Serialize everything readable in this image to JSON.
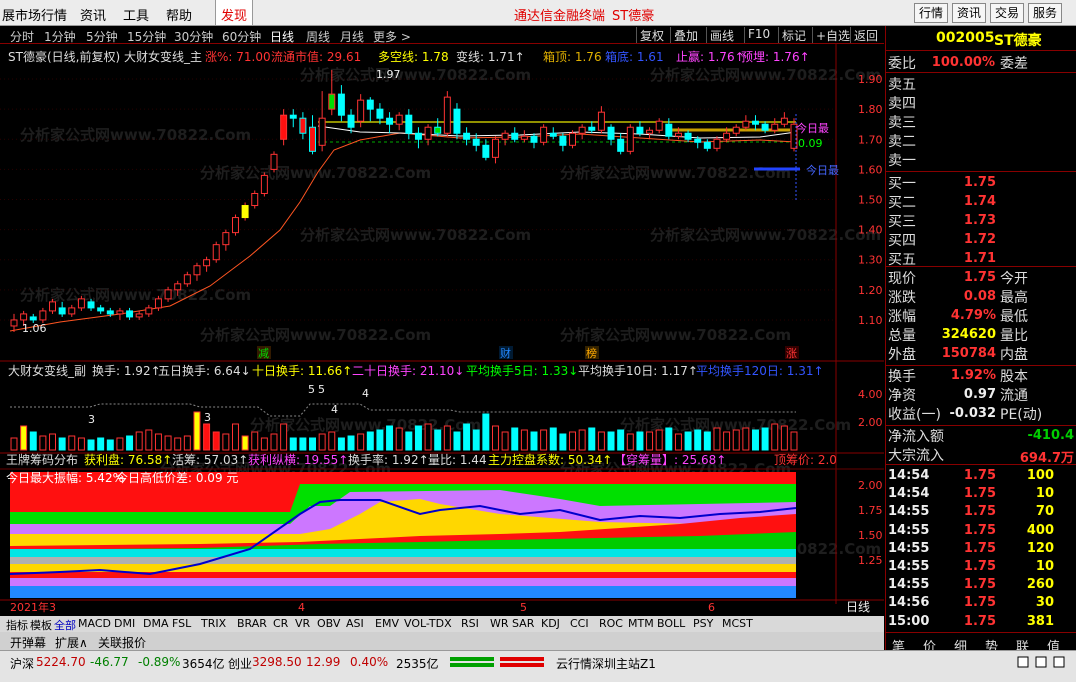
{
  "menu": {
    "left_items": [
      "展市场行情",
      "资讯",
      "工具",
      "帮助"
    ],
    "discover": "发现",
    "center": "通达信金融终端",
    "stock_title": "ST德豪",
    "buttons": [
      "行情",
      "资讯",
      "交易",
      "服务"
    ]
  },
  "timeframes": [
    "分时",
    "1分钟",
    "5分钟",
    "15分钟",
    "30分钟",
    "60分钟",
    "日线",
    "周线",
    "月线",
    "更多 >"
  ],
  "toolbar": [
    "复权",
    "叠加",
    "画线",
    "F10",
    "标记",
    "+自选",
    "返回"
  ],
  "main_header": {
    "name": "ST德豪(日线,前复权) 大财女变线_主",
    "zhang": "涨%: 71.00",
    "ltsz": "流通市值: 29.61",
    "dkx": "多空线: 1.78",
    "bxx": "变线: 1.71↑",
    "xd": "箱顶: 1.76",
    "xdi": "箱底: 1.61",
    "zy": "止赢: 1.76↑",
    "yl": "预埋: 1.76↑"
  },
  "main_axis": [
    "1.90",
    "1.80",
    "1.70",
    "1.60",
    "1.50",
    "1.40",
    "1.30",
    "1.20",
    "1.10"
  ],
  "main_labels": {
    "high": "1.97",
    "low": "1.06",
    "today_high": "今日最",
    "today_low": "今日最",
    "diff": "0.09"
  },
  "events": [
    "减",
    "财",
    "榜",
    "涨"
  ],
  "sub_header": {
    "name": "大财女变线_副",
    "hs": "换手: 1.92↑",
    "hs5": "五日换手: 6.64↓",
    "hs10": "十日换手: 11.66↑",
    "hs20": "二十日换手: 21.10↓",
    "avg5": "平均换手5日: 1.33↓",
    "avg10": "平均换手10日: 1.17↑",
    "avg120": "平均换手120日: 1.31↑"
  },
  "sub_axis": [
    "4.00",
    "2.00"
  ],
  "sub_labels": [
    "3",
    "3",
    "5",
    "5",
    "4",
    "4"
  ],
  "chip_header": {
    "name": "王牌筹码分布",
    "hl": "获利盘: 76.58↑",
    "hy": "活筹: 57.03↑",
    "hlzz": "获利纵横: 19.55↑",
    "hsl": "换手率: 1.92↑",
    "lb": "量比: 1.44",
    "zl": "主力控盘系数: 50.34↑",
    "cm": "【穿筹量】: 25.68↑",
    "dcj": "顶筹价: 2.0"
  },
  "chip_sub": {
    "zf": "今日最大振幅: 5.42%",
    "gd": "今日高低价差: 0.09 元"
  },
  "chip_axis": [
    "2.00",
    "1.75",
    "1.50",
    "1.25"
  ],
  "xaxis": {
    "year": "2021年3",
    "m4": "4",
    "m5": "5",
    "m6": "6",
    "period": "日线"
  },
  "indicator_tabs": [
    "指标",
    "模板",
    "全部",
    "MACD",
    "DMI",
    "DMA",
    "FSL",
    "TRIX",
    "BRAR",
    "CR",
    "VR",
    "OBV",
    "ASI",
    "EMV",
    "VOL-TDX",
    "RSI",
    "WR",
    "SAR",
    "KDJ",
    "CCI",
    "ROC",
    "MTM",
    "BOLL",
    "PSY",
    "MCST"
  ],
  "bottom_tabs": [
    "开弹幕",
    "扩展∧",
    "关联报价"
  ],
  "right": {
    "code": "002005",
    "name": "ST德豪",
    "wb_label": "委比",
    "wb_val": "100.00%",
    "wc_label": "委差",
    "asks": [
      "卖五",
      "卖四",
      "卖三",
      "卖二",
      "卖一"
    ],
    "bids": [
      {
        "l": "买一",
        "p": "1.75",
        "v": ""
      },
      {
        "l": "买二",
        "p": "1.74",
        "v": ""
      },
      {
        "l": "买三",
        "p": "1.73",
        "v": ""
      },
      {
        "l": "买四",
        "p": "1.72",
        "v": ""
      },
      {
        "l": "买五",
        "p": "1.71",
        "v": ""
      }
    ],
    "quote": [
      {
        "l": "现价",
        "v": "1.75",
        "r": "今开"
      },
      {
        "l": "涨跌",
        "v": "0.08",
        "r": "最高"
      },
      {
        "l": "涨幅",
        "v": "4.79%",
        "r": "最低"
      },
      {
        "l": "总量",
        "v": "324620",
        "r": "量比"
      },
      {
        "l": "外盘",
        "v": "150784",
        "r": "内盘"
      }
    ],
    "quote2": [
      {
        "l": "换手",
        "v": "1.92%",
        "r": "股本"
      },
      {
        "l": "净资",
        "v": "0.97",
        "r": "流通"
      },
      {
        "l": "收益(一)",
        "v": "-0.032",
        "r": "PE(动)"
      }
    ],
    "flow": [
      {
        "l": "净流入额",
        "v": "-410.4"
      },
      {
        "l": "大宗流入",
        "v": "694.7万"
      }
    ],
    "ticks": [
      {
        "t": "14:54",
        "p": "1.75",
        "v": "100"
      },
      {
        "t": "14:54",
        "p": "1.75",
        "v": "10"
      },
      {
        "t": "14:55",
        "p": "1.75",
        "v": "70"
      },
      {
        "t": "14:55",
        "p": "1.75",
        "v": "400"
      },
      {
        "t": "14:55",
        "p": "1.75",
        "v": "120"
      },
      {
        "t": "14:55",
        "p": "1.75",
        "v": "10"
      },
      {
        "t": "14:55",
        "p": "1.75",
        "v": "260"
      },
      {
        "t": "14:56",
        "p": "1.75",
        "v": "30"
      },
      {
        "t": "15:00",
        "p": "1.75",
        "v": "381"
      }
    ],
    "rtabs": [
      "笔",
      "价",
      "细",
      "势",
      "联",
      "值"
    ]
  },
  "status": {
    "sh": "沪深",
    "sh_v": "5224.70",
    "sh_c": "-46.77",
    "sh_p": "-0.89%",
    "sh_a": "3654亿",
    "cy": "创业",
    "cy_v": "3298.50",
    "cy_c": "12.99",
    "cy_p": "0.40%",
    "cy_a": "2535亿",
    "server": "云行情深圳主站Z1"
  },
  "watermark": "分析家公式网www.70822.Com",
  "candles": [
    {
      "o": 1.08,
      "c": 1.1,
      "h": 1.12,
      "l": 1.06
    },
    {
      "o": 1.1,
      "c": 1.12,
      "h": 1.13,
      "l": 1.08
    },
    {
      "o": 1.11,
      "c": 1.1,
      "h": 1.12,
      "l": 1.09
    },
    {
      "o": 1.1,
      "c": 1.13,
      "h": 1.14,
      "l": 1.09
    },
    {
      "o": 1.13,
      "c": 1.16,
      "h": 1.17,
      "l": 1.12
    },
    {
      "o": 1.14,
      "c": 1.12,
      "h": 1.16,
      "l": 1.11
    },
    {
      "o": 1.12,
      "c": 1.14,
      "h": 1.15,
      "l": 1.11
    },
    {
      "o": 1.14,
      "c": 1.17,
      "h": 1.18,
      "l": 1.13
    },
    {
      "o": 1.16,
      "c": 1.14,
      "h": 1.17,
      "l": 1.13
    },
    {
      "o": 1.14,
      "c": 1.13,
      "h": 1.15,
      "l": 1.12
    },
    {
      "o": 1.13,
      "c": 1.12,
      "h": 1.14,
      "l": 1.11
    },
    {
      "o": 1.12,
      "c": 1.13,
      "h": 1.14,
      "l": 1.1
    },
    {
      "o": 1.13,
      "c": 1.11,
      "h": 1.14,
      "l": 1.1
    },
    {
      "o": 1.11,
      "c": 1.12,
      "h": 1.13,
      "l": 1.1
    },
    {
      "o": 1.12,
      "c": 1.14,
      "h": 1.15,
      "l": 1.11
    },
    {
      "o": 1.14,
      "c": 1.17,
      "h": 1.18,
      "l": 1.13
    },
    {
      "o": 1.17,
      "c": 1.2,
      "h": 1.21,
      "l": 1.16
    },
    {
      "o": 1.2,
      "c": 1.22,
      "h": 1.23,
      "l": 1.18
    },
    {
      "o": 1.22,
      "c": 1.25,
      "h": 1.26,
      "l": 1.21
    },
    {
      "o": 1.25,
      "c": 1.28,
      "h": 1.29,
      "l": 1.23
    },
    {
      "o": 1.28,
      "c": 1.3,
      "h": 1.31,
      "l": 1.26
    },
    {
      "o": 1.3,
      "c": 1.35,
      "h": 1.36,
      "l": 1.29
    },
    {
      "o": 1.35,
      "c": 1.39,
      "h": 1.4,
      "l": 1.33
    },
    {
      "o": 1.39,
      "c": 1.44,
      "h": 1.45,
      "l": 1.38
    },
    {
      "o": 1.44,
      "c": 1.48,
      "h": 1.49,
      "l": 1.43
    },
    {
      "o": 1.48,
      "c": 1.52,
      "h": 1.53,
      "l": 1.47
    },
    {
      "o": 1.52,
      "c": 1.58,
      "h": 1.59,
      "l": 1.51
    },
    {
      "o": 1.6,
      "c": 1.65,
      "h": 1.66,
      "l": 1.59
    },
    {
      "o": 1.7,
      "c": 1.78,
      "h": 1.8,
      "l": 1.68
    },
    {
      "o": 1.78,
      "c": 1.77,
      "h": 1.8,
      "l": 1.74
    },
    {
      "o": 1.77,
      "c": 1.72,
      "h": 1.79,
      "l": 1.7
    },
    {
      "o": 1.74,
      "c": 1.66,
      "h": 1.78,
      "l": 1.65
    },
    {
      "o": 1.68,
      "c": 1.77,
      "h": 1.86,
      "l": 1.66
    },
    {
      "o": 1.8,
      "c": 1.85,
      "h": 1.93,
      "l": 1.78
    },
    {
      "o": 1.85,
      "c": 1.78,
      "h": 1.88,
      "l": 1.76
    },
    {
      "o": 1.78,
      "c": 1.74,
      "h": 1.8,
      "l": 1.72
    },
    {
      "o": 1.76,
      "c": 1.83,
      "h": 1.85,
      "l": 1.74
    },
    {
      "o": 1.83,
      "c": 1.8,
      "h": 1.84,
      "l": 1.76
    },
    {
      "o": 1.8,
      "c": 1.77,
      "h": 1.82,
      "l": 1.75
    },
    {
      "o": 1.77,
      "c": 1.75,
      "h": 1.79,
      "l": 1.72
    },
    {
      "o": 1.75,
      "c": 1.78,
      "h": 1.79,
      "l": 1.73
    },
    {
      "o": 1.78,
      "c": 1.72,
      "h": 1.8,
      "l": 1.7
    },
    {
      "o": 1.72,
      "c": 1.7,
      "h": 1.74,
      "l": 1.67
    },
    {
      "o": 1.7,
      "c": 1.74,
      "h": 1.75,
      "l": 1.68
    },
    {
      "o": 1.74,
      "c": 1.72,
      "h": 1.77,
      "l": 1.71
    },
    {
      "o": 1.72,
      "c": 1.84,
      "h": 1.86,
      "l": 1.71
    },
    {
      "o": 1.8,
      "c": 1.72,
      "h": 1.82,
      "l": 1.7
    },
    {
      "o": 1.72,
      "c": 1.7,
      "h": 1.74,
      "l": 1.68
    },
    {
      "o": 1.7,
      "c": 1.68,
      "h": 1.72,
      "l": 1.66
    },
    {
      "o": 1.68,
      "c": 1.64,
      "h": 1.7,
      "l": 1.63
    },
    {
      "o": 1.64,
      "c": 1.7,
      "h": 1.71,
      "l": 1.62
    },
    {
      "o": 1.7,
      "c": 1.72,
      "h": 1.73,
      "l": 1.68
    },
    {
      "o": 1.72,
      "c": 1.7,
      "h": 1.74,
      "l": 1.69
    },
    {
      "o": 1.7,
      "c": 1.71,
      "h": 1.73,
      "l": 1.69
    },
    {
      "o": 1.71,
      "c": 1.69,
      "h": 1.72,
      "l": 1.67
    },
    {
      "o": 1.69,
      "c": 1.74,
      "h": 1.75,
      "l": 1.68
    },
    {
      "o": 1.72,
      "c": 1.71,
      "h": 1.74,
      "l": 1.7
    },
    {
      "o": 1.71,
      "c": 1.68,
      "h": 1.72,
      "l": 1.66
    },
    {
      "o": 1.68,
      "c": 1.72,
      "h": 1.73,
      "l": 1.67
    },
    {
      "o": 1.72,
      "c": 1.74,
      "h": 1.75,
      "l": 1.7
    },
    {
      "o": 1.74,
      "c": 1.73,
      "h": 1.76,
      "l": 1.72
    },
    {
      "o": 1.73,
      "c": 1.79,
      "h": 1.81,
      "l": 1.72
    },
    {
      "o": 1.74,
      "c": 1.7,
      "h": 1.75,
      "l": 1.68
    },
    {
      "o": 1.7,
      "c": 1.66,
      "h": 1.72,
      "l": 1.65
    },
    {
      "o": 1.66,
      "c": 1.74,
      "h": 1.75,
      "l": 1.65
    },
    {
      "o": 1.74,
      "c": 1.72,
      "h": 1.76,
      "l": 1.71
    },
    {
      "o": 1.72,
      "c": 1.73,
      "h": 1.74,
      "l": 1.7
    },
    {
      "o": 1.73,
      "c": 1.76,
      "h": 1.77,
      "l": 1.72
    },
    {
      "o": 1.75,
      "c": 1.71,
      "h": 1.77,
      "l": 1.7
    },
    {
      "o": 1.71,
      "c": 1.72,
      "h": 1.74,
      "l": 1.7
    },
    {
      "o": 1.72,
      "c": 1.7,
      "h": 1.73,
      "l": 1.69
    },
    {
      "o": 1.7,
      "c": 1.69,
      "h": 1.71,
      "l": 1.67
    },
    {
      "o": 1.69,
      "c": 1.67,
      "h": 1.7,
      "l": 1.66
    },
    {
      "o": 1.67,
      "c": 1.7,
      "h": 1.71,
      "l": 1.66
    },
    {
      "o": 1.7,
      "c": 1.72,
      "h": 1.74,
      "l": 1.69
    },
    {
      "o": 1.72,
      "c": 1.74,
      "h": 1.75,
      "l": 1.71
    },
    {
      "o": 1.74,
      "c": 1.76,
      "h": 1.78,
      "l": 1.73
    },
    {
      "o": 1.76,
      "c": 1.75,
      "h": 1.78,
      "l": 1.73
    },
    {
      "o": 1.75,
      "c": 1.73,
      "h": 1.76,
      "l": 1.72
    },
    {
      "o": 1.73,
      "c": 1.75,
      "h": 1.77,
      "l": 1.72
    },
    {
      "o": 1.75,
      "c": 1.77,
      "h": 1.79,
      "l": 1.74
    },
    {
      "o": 1.67,
      "c": 1.75,
      "h": 1.77,
      "l": 1.66
    }
  ],
  "volumes": [
    0.6,
    1.2,
    0.9,
    0.7,
    0.8,
    0.6,
    0.7,
    0.6,
    0.5,
    0.6,
    0.5,
    0.6,
    0.7,
    0.9,
    1.0,
    0.8,
    0.7,
    0.6,
    0.7,
    1.9,
    1.3,
    0.9,
    0.8,
    1.3,
    0.7,
    0.9,
    0.6,
    0.8,
    1.3,
    0.6,
    0.6,
    0.6,
    0.8,
    0.9,
    0.6,
    0.7,
    0.8,
    0.9,
    1.0,
    1.2,
    1.1,
    0.9,
    1.2,
    1.3,
    1.0,
    1.2,
    0.9,
    1.3,
    1.0,
    1.8,
    1.2,
    0.9,
    1.1,
    1.0,
    0.9,
    1.0,
    1.1,
    0.8,
    0.9,
    1.0,
    1.1,
    0.9,
    0.9,
    1.0,
    0.8,
    0.9,
    0.9,
    1.0,
    1.1,
    0.8,
    0.9,
    1.0,
    0.9,
    1.1,
    0.9,
    1.0,
    1.1,
    1.0,
    1.1,
    1.3,
    1.2,
    0.9
  ]
}
